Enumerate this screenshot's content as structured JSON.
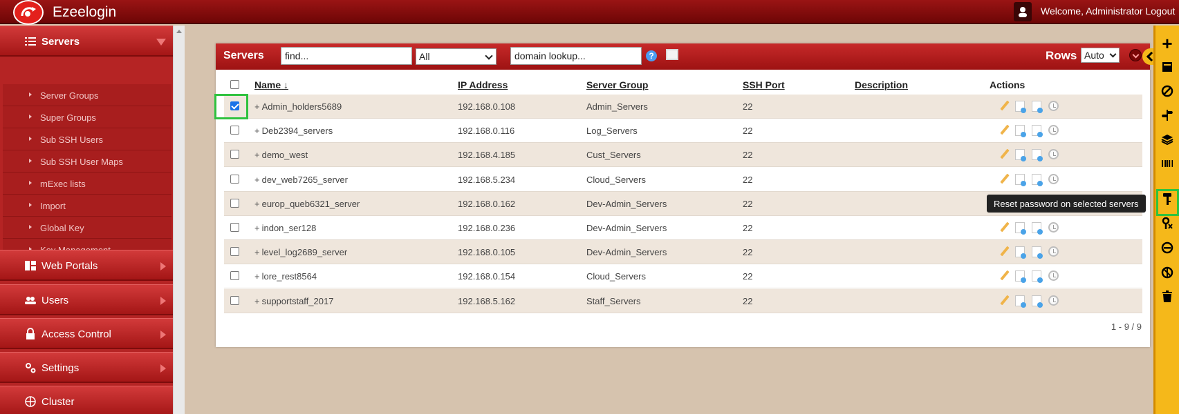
{
  "header": {
    "app_title": "Ezeelogin",
    "welcome": "Welcome, Administrator Logout"
  },
  "sidebar": {
    "sections": [
      {
        "label": "Servers",
        "active": true
      },
      {
        "label": "Web Portals"
      },
      {
        "label": "Users"
      },
      {
        "label": "Access Control"
      },
      {
        "label": "Settings"
      },
      {
        "label": "Cluster"
      }
    ],
    "server_subitems": [
      "Server Groups",
      "Super Groups",
      "Sub SSH Users",
      "Sub SSH User Maps",
      "mExec lists",
      "Import",
      "Global Key",
      "Key Management"
    ]
  },
  "panel": {
    "title": "Servers",
    "find_placeholder": "find...",
    "group_filter": "All",
    "domain_placeholder": "domain lookup...",
    "help_icon": "?",
    "rows_label": "Rows",
    "rows_value": "Auto",
    "pager": "1 - 9 / 9"
  },
  "table": {
    "columns": {
      "name": "Name",
      "ip": "IP Address",
      "group": "Server Group",
      "port": "SSH Port",
      "description": "Description",
      "actions": "Actions"
    },
    "rows": [
      {
        "name": "Admin_holders5689",
        "ip": "192.168.0.108",
        "group": "Admin_Servers",
        "port": "22",
        "checked": true
      },
      {
        "name": "Deb2394_servers",
        "ip": "192.168.0.116",
        "group": "Log_Servers",
        "port": "22"
      },
      {
        "name": "demo_west",
        "ip": "192.168.4.185",
        "group": "Cust_Servers",
        "port": "22"
      },
      {
        "name": "dev_web7265_server",
        "ip": "192.168.5.234",
        "group": "Cloud_Servers",
        "port": "22"
      },
      {
        "name": "europ_queb6321_server",
        "ip": "192.168.0.162",
        "group": "Dev-Admin_Servers",
        "port": "22"
      },
      {
        "name": "indon_ser128",
        "ip": "192.168.0.236",
        "group": "Dev-Admin_Servers",
        "port": "22"
      },
      {
        "name": "level_log2689_server",
        "ip": "192.168.0.105",
        "group": "Dev-Admin_Servers",
        "port": "22"
      },
      {
        "name": "lore_rest8564",
        "ip": "192.168.0.154",
        "group": "Cloud_Servers",
        "port": "22"
      },
      {
        "name": "supportstaff_2017",
        "ip": "192.168.5.162",
        "group": "Staff_Servers",
        "port": "22"
      }
    ],
    "plus": "+"
  },
  "toolbar": {
    "tooltip": "Reset password on selected servers",
    "icons": [
      "plus-icon",
      "terminal-icon",
      "block-icon",
      "signpost-icon",
      "layers-icon",
      "barcode-icon",
      "key-icon",
      "key-remove-icon",
      "minus-circle-icon",
      "globe-icon",
      "trash-icon"
    ],
    "plus_glyph": "+"
  },
  "colors": {
    "brand_red": "#b52424",
    "toolbar_yellow": "#f5b81a",
    "highlight_green": "#2fc23f"
  }
}
